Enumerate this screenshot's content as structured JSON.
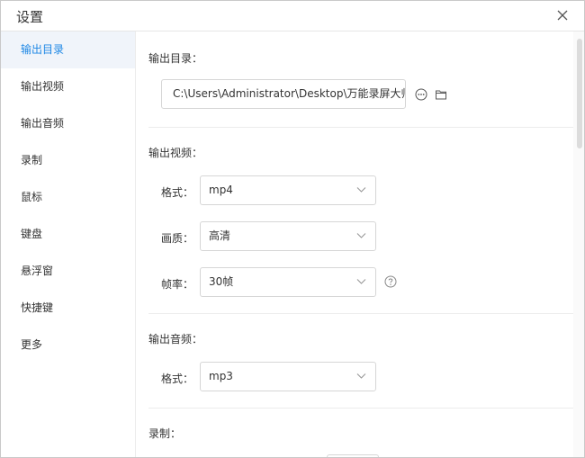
{
  "window": {
    "title": "设置",
    "close_icon": "close-icon"
  },
  "sidebar": {
    "items": [
      {
        "label": "输出目录"
      },
      {
        "label": "输出视频"
      },
      {
        "label": "输出音频"
      },
      {
        "label": "录制"
      },
      {
        "label": "鼠标"
      },
      {
        "label": "键盘"
      },
      {
        "label": "悬浮窗"
      },
      {
        "label": "快捷键"
      },
      {
        "label": "更多"
      }
    ],
    "active_index": 0,
    "active_color": "#1e88e5"
  },
  "output_dir": {
    "section_label": "输出目录：",
    "path": "C:\\Users\\Administrator\\Desktop\\万能录屏大师",
    "more_icon": "more-dots-icon",
    "folder_icon": "folder-icon"
  },
  "output_video": {
    "section_label": "输出视频：",
    "format_label": "格式：",
    "format_value": "mp4",
    "quality_label": "画质：",
    "quality_value": "高清",
    "fps_label": "帧率：",
    "fps_value": "30帧",
    "help_icon": "help-icon"
  },
  "output_audio": {
    "section_label": "输出音频：",
    "format_label": "格式：",
    "format_value": "mp3"
  },
  "record": {
    "section_label": "录制："
  }
}
